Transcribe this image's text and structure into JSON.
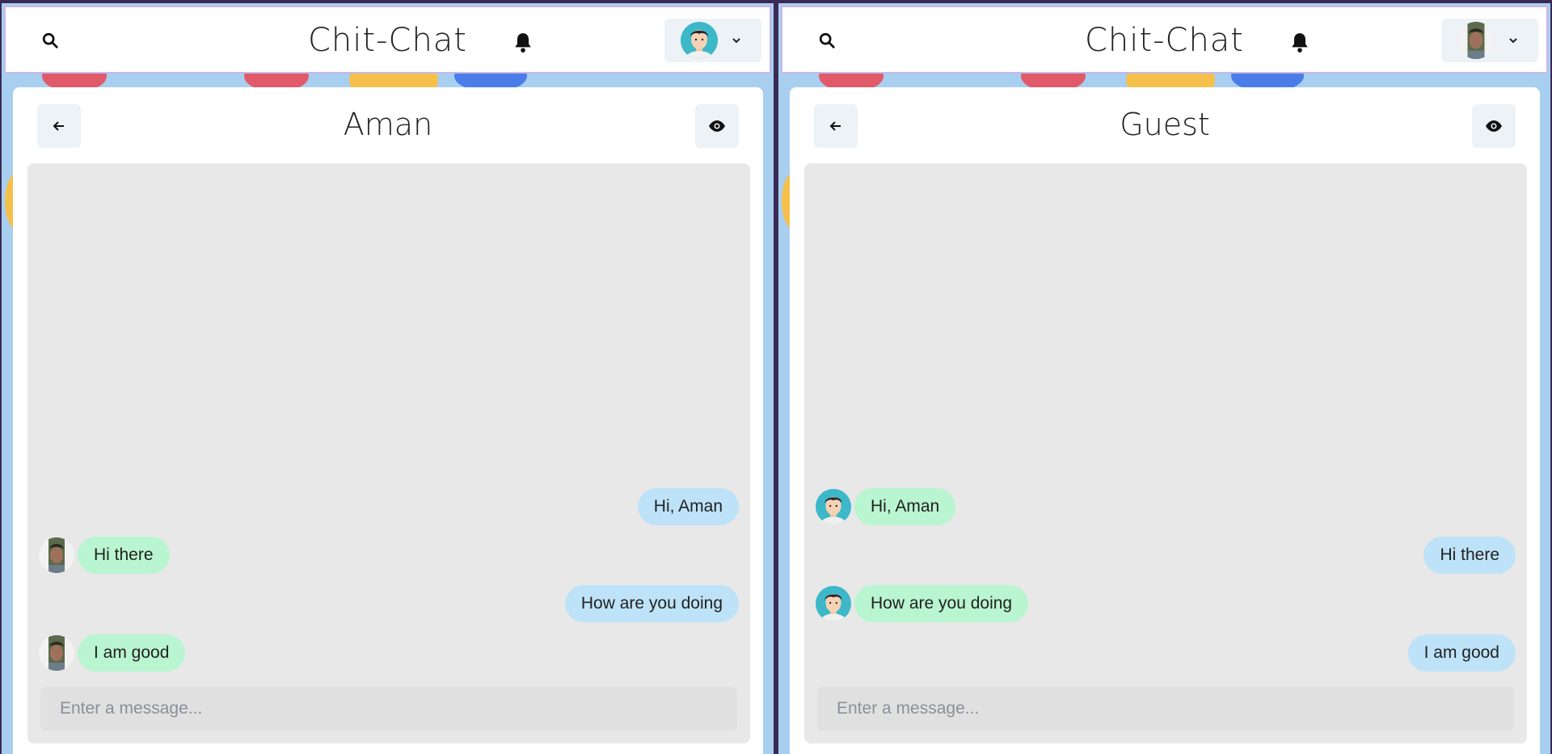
{
  "app": {
    "title": "Chit-Chat"
  },
  "left_window": {
    "chat_title": "Aman",
    "input_placeholder": "Enter a message...",
    "current_user_avatar": "cartoon-man-avatar",
    "messages": [
      {
        "text": "Hi, Aman",
        "mine": true
      },
      {
        "text": "Hi there",
        "mine": false,
        "avatar": "photo-woman-avatar"
      },
      {
        "text": "How are you doing",
        "mine": true
      },
      {
        "text": "I am good",
        "mine": false,
        "avatar": "photo-woman-avatar"
      }
    ]
  },
  "right_window": {
    "chat_title": "Guest",
    "input_placeholder": "Enter a message...",
    "current_user_avatar": "photo-woman-avatar",
    "messages": [
      {
        "text": "Hi, Aman",
        "mine": false,
        "avatar": "cartoon-man-avatar"
      },
      {
        "text": "Hi there",
        "mine": true
      },
      {
        "text": "How are you doing",
        "mine": false,
        "avatar": "cartoon-man-avatar"
      },
      {
        "text": "I am good",
        "mine": true
      }
    ]
  },
  "colors": {
    "incoming_bubble": "#b9f5d0",
    "outgoing_bubble": "#bee3f8",
    "chat_area": "#e8e8e8",
    "button_bg": "#edf2f7"
  }
}
